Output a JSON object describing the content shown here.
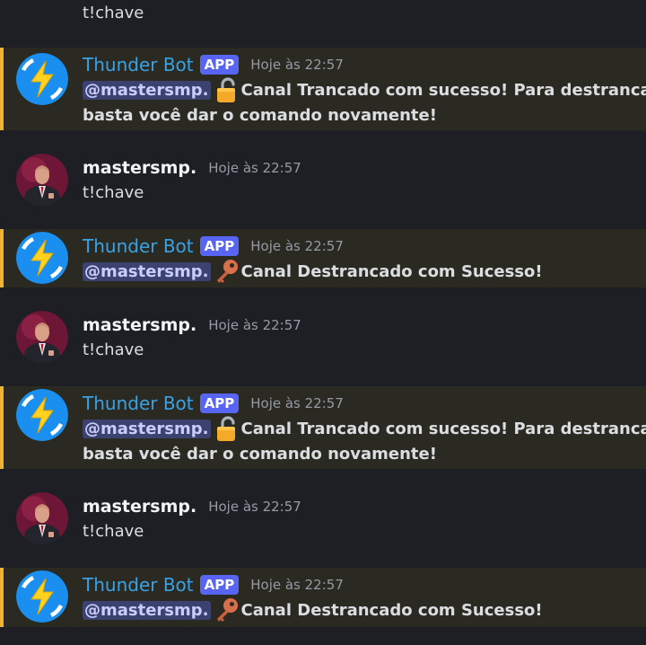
{
  "top_fragment": {
    "text": "t!chave"
  },
  "messages": [
    {
      "author": "Thunder Bot",
      "badge": "APP",
      "timestamp": "Hoje às 22:57",
      "mention": "@mastersmp.",
      "emoji": "lock-icon",
      "line1": "Canal Trancado com sucesso! Para destrancar",
      "line2": "basta você dar o comando novamente!"
    },
    {
      "author": "mastersmp.",
      "timestamp": "Hoje às 22:57",
      "text": "t!chave"
    },
    {
      "author": "Thunder Bot",
      "badge": "APP",
      "timestamp": "Hoje às 22:57",
      "mention": "@mastersmp.",
      "emoji": "key-icon",
      "line1": "Canal Destrancado com Sucesso!"
    },
    {
      "author": "mastersmp.",
      "timestamp": "Hoje às 22:57",
      "text": "t!chave"
    },
    {
      "author": "Thunder Bot",
      "badge": "APP",
      "timestamp": "Hoje às 22:57",
      "mention": "@mastersmp.",
      "emoji": "lock-icon",
      "line1": "Canal Trancado com sucesso! Para destrancar",
      "line2": "basta você dar o comando novamente!"
    },
    {
      "author": "mastersmp.",
      "timestamp": "Hoje às 22:57",
      "text": "t!chave"
    },
    {
      "author": "Thunder Bot",
      "badge": "APP",
      "timestamp": "Hoje às 22:57",
      "mention": "@mastersmp.",
      "emoji": "key-icon",
      "line1": "Canal Destrancado com Sucesso!"
    }
  ],
  "colors": {
    "background": "#1e1f24",
    "highlight_bg": "#2b2a22",
    "highlight_bar": "#f0b232",
    "bot_name": "#3aa2e4",
    "app_badge": "#5865f2",
    "mention_bg": "#3c4270"
  }
}
